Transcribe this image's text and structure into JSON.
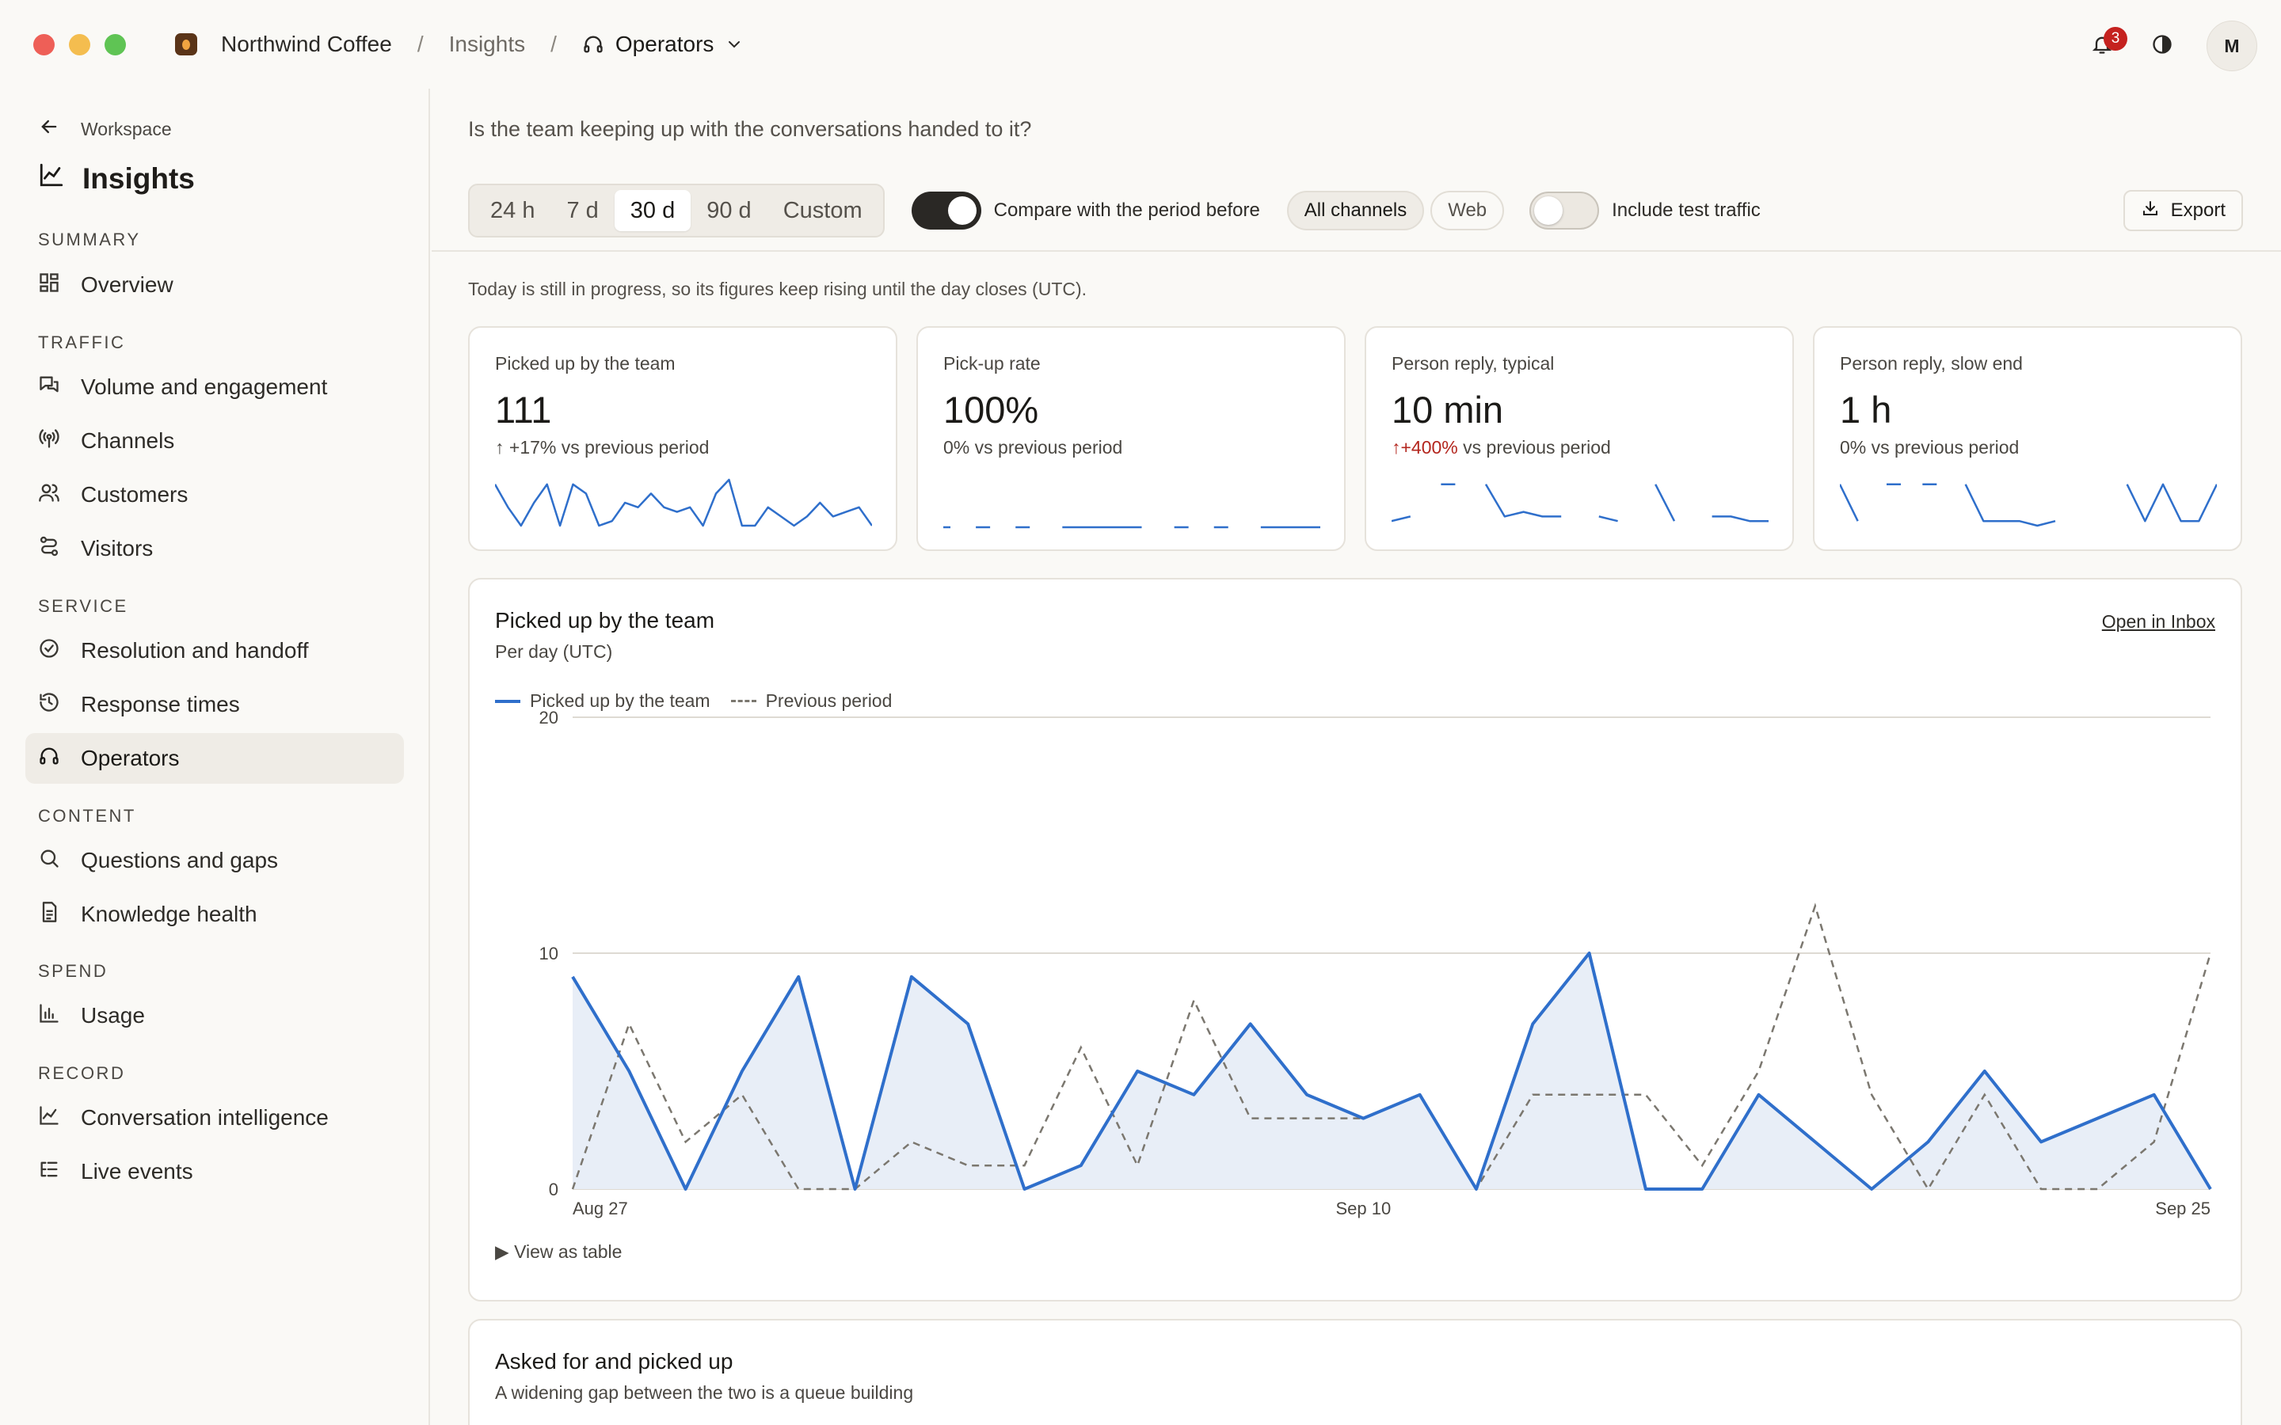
{
  "window": {
    "brand": "Northwind Coffee",
    "breadcrumb_insights": "Insights",
    "breadcrumb_current": "Operators",
    "notification_count": "3",
    "avatar_initial": "M",
    "colors": {
      "close": "#ee5f57",
      "minimize": "#f4bd4f",
      "zoom": "#5fc454"
    }
  },
  "sidebar": {
    "back_label": "Workspace",
    "title": "Insights",
    "sections": {
      "summary": "SUMMARY",
      "traffic": "TRAFFIC",
      "service": "SERVICE",
      "content": "CONTENT",
      "spend": "SPEND",
      "record": "RECORD"
    },
    "items": {
      "overview": "Overview",
      "volume": "Volume and engagement",
      "channels": "Channels",
      "customers": "Customers",
      "visitors": "Visitors",
      "resolution": "Resolution and handoff",
      "response_times": "Response times",
      "operators": "Operators",
      "questions": "Questions and gaps",
      "knowledge": "Knowledge health",
      "usage": "Usage",
      "conversation_intel": "Conversation intelligence",
      "live_events": "Live events"
    },
    "active_item": "operators"
  },
  "main": {
    "question": "Is the team keeping up with the conversations handed to it?",
    "ranges": [
      "24 h",
      "7 d",
      "30 d",
      "90 d",
      "Custom"
    ],
    "selected_range": "30 d",
    "compare_label": "Compare with the period before",
    "compare_enabled": true,
    "channels": [
      "All channels",
      "Web"
    ],
    "selected_channel": "All channels",
    "test_traffic_label": "Include test traffic",
    "test_traffic_enabled": false,
    "export_label": "Export",
    "note": "Today is still in progress, so its figures keep rising until the day closes (UTC)."
  },
  "kpis": [
    {
      "label": "Picked up by the team",
      "value": "111",
      "delta_arrow": "↑",
      "delta_value": "+17%",
      "delta_rest": "vs previous period",
      "delta_tone": "neutral"
    },
    {
      "label": "Pick-up rate",
      "value": "100%",
      "delta_arrow": "",
      "delta_value": "0%",
      "delta_rest": "vs previous period",
      "delta_tone": "neutral"
    },
    {
      "label": "Person reply, typical",
      "value": "10 min",
      "delta_arrow": "↑",
      "delta_value": "+400%",
      "delta_rest": "vs previous period",
      "delta_tone": "bad"
    },
    {
      "label": "Person reply, slow end",
      "value": "1 h",
      "delta_arrow": "",
      "delta_value": "0%",
      "delta_rest": "vs previous period",
      "delta_tone": "neutral"
    }
  ],
  "sparklines": {
    "picked_up": [
      9,
      4,
      0,
      5,
      9,
      0,
      9,
      7,
      0,
      1,
      5,
      4,
      7,
      4,
      3,
      4,
      0,
      7,
      10,
      0,
      0,
      4,
      2,
      0,
      2,
      5,
      2,
      3,
      4,
      0
    ],
    "pickup_rate": [
      100,
      null,
      100,
      null,
      100,
      null,
      100,
      100,
      100,
      100,
      100,
      null,
      100,
      null,
      100,
      null,
      100,
      100,
      100,
      100
    ],
    "reply_typical": [
      1,
      2,
      null,
      9,
      null,
      9,
      2,
      3,
      2,
      2,
      null,
      2,
      1,
      null,
      9,
      1,
      null,
      2,
      2,
      1,
      1
    ],
    "reply_slow": [
      9,
      1,
      null,
      9,
      null,
      9,
      null,
      9,
      1,
      1,
      1,
      0,
      1,
      null,
      null,
      null,
      9,
      1,
      9,
      1,
      1,
      9
    ]
  },
  "chart": {
    "title": "Picked up by the team",
    "subtitle": "Per day (UTC)",
    "open_link": "Open in Inbox",
    "view_table": "▶ View as table",
    "colors": {
      "current": "#2f6fcb",
      "current_fill": "#e8eef7",
      "previous": "#7b776f",
      "grid": "#dedad3"
    }
  },
  "chart_data": {
    "type": "area",
    "x": [
      "Aug 27",
      "Aug 28",
      "Aug 29",
      "Aug 30",
      "Aug 31",
      "Sep 1",
      "Sep 2",
      "Sep 3",
      "Sep 4",
      "Sep 5",
      "Sep 6",
      "Sep 7",
      "Sep 8",
      "Sep 9",
      "Sep 10",
      "Sep 11",
      "Sep 12",
      "Sep 13",
      "Sep 14",
      "Sep 15",
      "Sep 16",
      "Sep 17",
      "Sep 18",
      "Sep 19",
      "Sep 20",
      "Sep 21",
      "Sep 22",
      "Sep 23",
      "Sep 24",
      "Sep 25"
    ],
    "x_tick_labels": [
      "Aug 27",
      "Sep 10",
      "Sep 25"
    ],
    "series": [
      {
        "name": "Picked up by the team",
        "style": "solid-area",
        "values": [
          9,
          5,
          0,
          5,
          9,
          0,
          9,
          7,
          0,
          1,
          5,
          4,
          7,
          4,
          3,
          4,
          0,
          7,
          10,
          0,
          0,
          4,
          2,
          0,
          2,
          5,
          2,
          3,
          4,
          0
        ]
      },
      {
        "name": "Previous period",
        "style": "dashed",
        "values": [
          0,
          7,
          2,
          4,
          0,
          0,
          2,
          1,
          1,
          6,
          1,
          8,
          3,
          3,
          3,
          4,
          0,
          4,
          4,
          4,
          1,
          5,
          12,
          4,
          0,
          4,
          0,
          0,
          2,
          10
        ]
      }
    ],
    "ylim": [
      0,
      20
    ],
    "y_ticks": [
      0,
      10,
      20
    ],
    "grid": true,
    "legend": "top-left"
  },
  "card2": {
    "title": "Asked for and picked up",
    "subtitle": "A widening gap between the two is a queue building"
  }
}
